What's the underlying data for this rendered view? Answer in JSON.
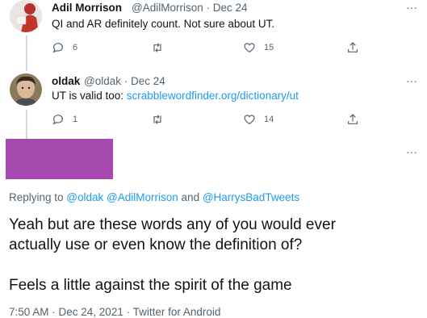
{
  "colors": {
    "accent": "#1d9bf0",
    "muted": "#536471",
    "text": "#0f1419",
    "redacted": "#a64ab0"
  },
  "tweets": [
    {
      "name": "Adil Morrison",
      "handle": "@AdilMorrison",
      "separator": "·",
      "date": "Dec 24",
      "text": "QI and AR definitely count. Not sure about UT.",
      "replies": "6",
      "retweets": "",
      "likes": "15"
    },
    {
      "name": "oldak",
      "handle": "@oldak",
      "separator": "·",
      "date": "Dec 24",
      "text_prefix": "UT is valid too: ",
      "link": "scrabblewordfinder.org/dictionary/ut",
      "replies": "1",
      "retweets": "",
      "likes": "14"
    }
  ],
  "main": {
    "replying_to_label": "Replying to ",
    "mentions": [
      "@oldak",
      "@AdilMorrison",
      "@HarrysBadTweets"
    ],
    "and_word": "and",
    "body_line1": "Yeah but are these words any of you would ever",
    "body_line2": "actually use or even know the definition of?",
    "body_line3": "Feels a little against the spirit of the game",
    "footer": "7:50 AM · Dec 24, 2021 · Twitter for Android"
  },
  "more_label": "···"
}
